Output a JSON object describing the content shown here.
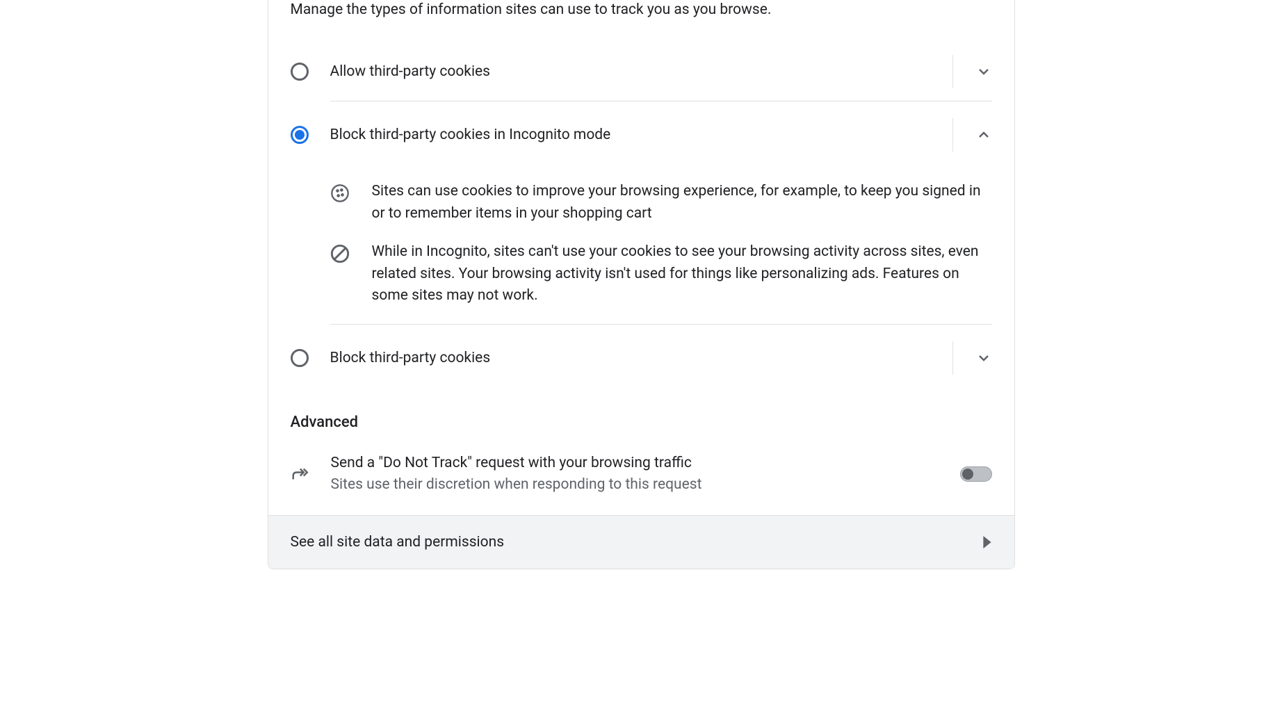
{
  "description": "Manage the types of information sites can use to track you as you browse.",
  "options": [
    {
      "label": "Allow third-party cookies",
      "selected": false,
      "expanded": false
    },
    {
      "label": "Block third-party cookies in Incognito mode",
      "selected": true,
      "expanded": true
    },
    {
      "label": "Block third-party cookies",
      "selected": false,
      "expanded": false
    }
  ],
  "info": {
    "cookie_text": "Sites can use cookies to improve your browsing experience, for example, to keep you signed in or to remember items in your shopping cart",
    "block_text": "While in Incognito, sites can't use your cookies to see your browsing activity across sites, even related sites. Your browsing activity isn't used for things like personalizing ads. Features on some sites may not work."
  },
  "advanced": {
    "header": "Advanced",
    "dnt_title": "Send a \"Do Not Track\" request with your browsing traffic",
    "dnt_subtitle": "Sites use their discretion when responding to this request",
    "dnt_enabled": false
  },
  "footer": {
    "label": "See all site data and permissions"
  }
}
